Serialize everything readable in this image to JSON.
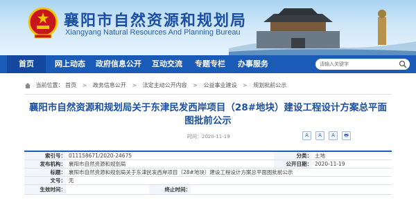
{
  "header": {
    "title": "襄阳市自然资源和规划局",
    "subtitle": "Xiangyang Natural Resources And Planning Bureau"
  },
  "nav": {
    "items": [
      "首页",
      "网上动态",
      "政府信息公开",
      "互动交流",
      "专题专栏",
      "办事服务"
    ],
    "active_index": 0,
    "search_placeholder": "请输入关键字"
  },
  "breadcrumb": {
    "prefix": "当前位置：",
    "items": [
      "首页",
      "政务信息公开",
      "法定主动公开内容",
      "公益事业建设",
      "规划批前公示"
    ]
  },
  "article": {
    "title": "襄阳市自然资源和规划局关于东津民发西岸项目（28#地块）建设工程设计方案总平面图批前公示",
    "time_label": "时间：",
    "time": "2020-11-19",
    "font_tools": [
      "A",
      "A",
      "A",
      "🖶"
    ]
  },
  "meta": {
    "index_label": "索引号：",
    "index_value": "011158671/2020-24675",
    "category_label": "分类：",
    "category_value": "土地",
    "publisher_label": "发布机构：",
    "publisher_value": "襄阳市自然资源和规划局",
    "pubdate_label": "公开日期：",
    "pubdate_value": "2020-11-19",
    "subject_label": "标题：",
    "subject_value": "襄阳市自然资源和规划局关于东津民发西岸项目（28#地块）建设工程设计方案总平面图批前公示",
    "docno_label": "文号：",
    "docno_value": "无",
    "effective_label": "生效时间：",
    "effective_value": "",
    "expire_label": "终止时间：",
    "expire_value": ""
  },
  "colors": {
    "brand_blue": "#1a5bb8",
    "title_blue": "#1a4fa3",
    "emblem_red": "#c8161d",
    "emblem_gold": "#f5c400"
  }
}
